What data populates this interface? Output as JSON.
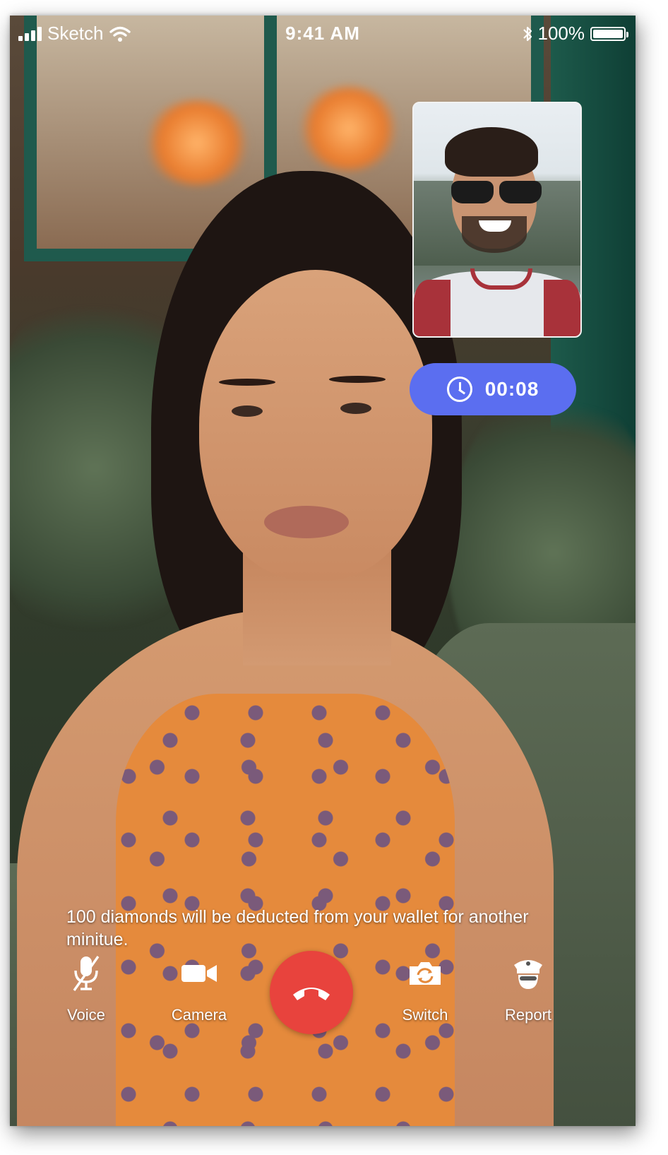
{
  "status_bar": {
    "carrier": "Sketch",
    "time": "9:41 AM",
    "battery": "100%",
    "battery_level": 1.0,
    "icons": [
      "signal-icon",
      "wifi-icon",
      "bluetooth-icon",
      "battery-icon"
    ]
  },
  "call": {
    "timer": "00:08",
    "timer_color": "#5b6ef0",
    "notice": "100 diamonds will be deducted from your wallet for another minitue."
  },
  "controls": {
    "voice_label": "Voice",
    "camera_label": "Camera",
    "switch_label": "Switch",
    "report_label": "Report",
    "hangup_color": "#e8433d",
    "icons": [
      "mic-off-icon",
      "video-camera-icon",
      "end-call-icon",
      "switch-camera-icon",
      "report-icon"
    ]
  }
}
